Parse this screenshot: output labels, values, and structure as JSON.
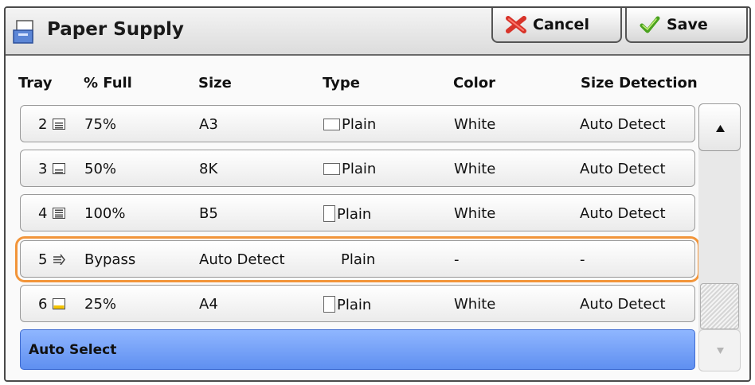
{
  "header": {
    "title": "Paper Supply",
    "title_icon": "paper-supply-icon",
    "cancel_label": "Cancel",
    "save_label": "Save"
  },
  "table": {
    "columns": [
      "Tray",
      "% Full",
      "Size",
      "Type",
      "Color",
      "Size Detection"
    ],
    "rows": [
      {
        "tray": "2",
        "icon": "tray-icon",
        "full": "75%",
        "size": "A3",
        "type": "Plain",
        "orientation": "landscape",
        "color": "White",
        "detection": "Auto Detect"
      },
      {
        "tray": "3",
        "icon": "tray-icon",
        "full": "50%",
        "size": "8K",
        "type": "Plain",
        "orientation": "landscape",
        "color": "White",
        "detection": "Auto Detect"
      },
      {
        "tray": "4",
        "icon": "tray-icon",
        "full": "100%",
        "size": "B5",
        "type": "Plain",
        "orientation": "portrait",
        "color": "White",
        "detection": "Auto Detect"
      },
      {
        "tray": "5",
        "icon": "bypass-tray-icon",
        "full": "Bypass",
        "size": "Auto Detect",
        "type": "Plain",
        "orientation": "none",
        "color": "-",
        "detection": "-"
      },
      {
        "tray": "6",
        "icon": "tray-icon-yellow",
        "full": "25%",
        "size": "A4",
        "type": "Plain",
        "orientation": "portrait",
        "color": "White",
        "detection": "Auto Detect"
      }
    ],
    "selected_row_index": 3,
    "auto_select_label": "Auto Select"
  },
  "colors": {
    "selection_highlight": "#f2953a",
    "auto_select_bg": "#6f9cf5"
  }
}
